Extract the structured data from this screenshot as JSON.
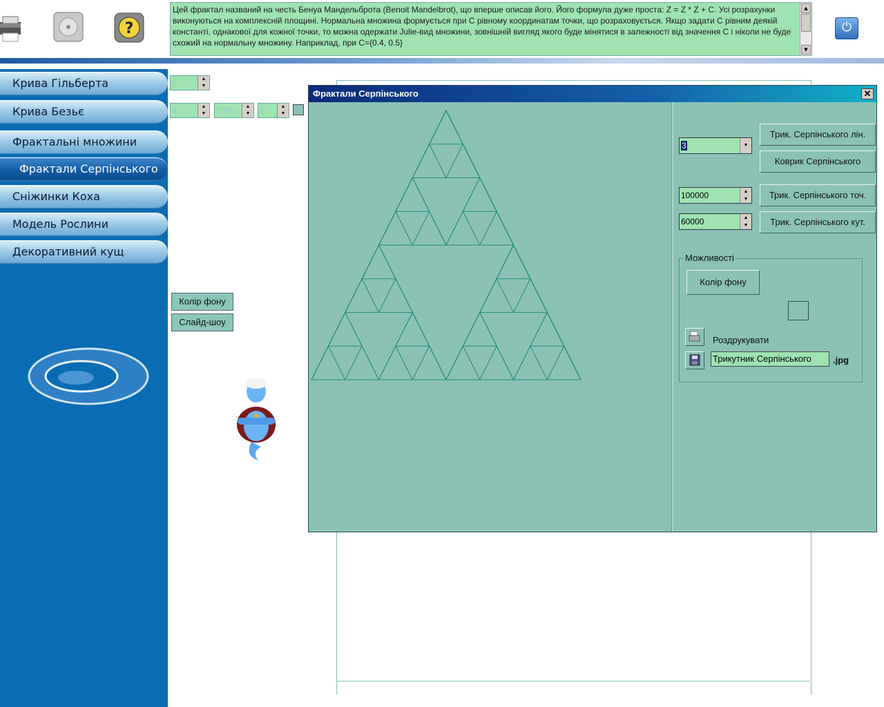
{
  "toolbar": {
    "info_text": "Цей фрактал названий на честь Бенуа Мандельброта (Benoit Mandelbrot), що вперше описав його. Його формула дуже проста: Z = Z * Z + C. Усі розрахунки виконуються на комплексній площині. Нормальна множина формується при C рівному координатам точки, що розраховується. Якщо задати C рівним деякій константі, однакової для кожної точки, то можна одержати Julie-вид множини, зовнішній вигляд якого буде мінятися в залежності від значення C і ніколи не буде схожий на нормальну множину. Наприклад, при C={0.4, 0.5}"
  },
  "menu": {
    "items": [
      {
        "label": "Крива Гільберта"
      },
      {
        "label": "Крива Безьє"
      },
      {
        "label": "Фрактальні множини"
      },
      {
        "label": "Фрактали Серпінського"
      },
      {
        "label": "Сніжинки Коха"
      },
      {
        "label": "Модель Рослини"
      },
      {
        "label": "Декоративний кущ"
      }
    ]
  },
  "left_controls": {
    "spin1": "5",
    "spin2": "1",
    "spin3": "2000",
    "spin4": "1",
    "bg_color_button": "Колір фону",
    "slideshow_button": "Слайд-шоу"
  },
  "dialog": {
    "title": "Фрактали Серпінського",
    "close": "✕",
    "depth_value": "3",
    "points_value": "100000",
    "angle_value": "60000",
    "btn_triangle_lines": "Трик. Серпінського лін.",
    "btn_carpet": "Коврик Серпінського",
    "btn_triangle_points": "Трик. Серпінського точ.",
    "btn_triangle_angle": "Трик. Серпінського кут.",
    "options_group": "Можливості",
    "options_bg_color": "Колір фону",
    "print_label": "Роздрукувати",
    "filename_value": "Трикутник Серпінського",
    "extension": ".jpg",
    "colors": {
      "line": "#1f8a7a",
      "background": "#8bc2b5"
    }
  }
}
